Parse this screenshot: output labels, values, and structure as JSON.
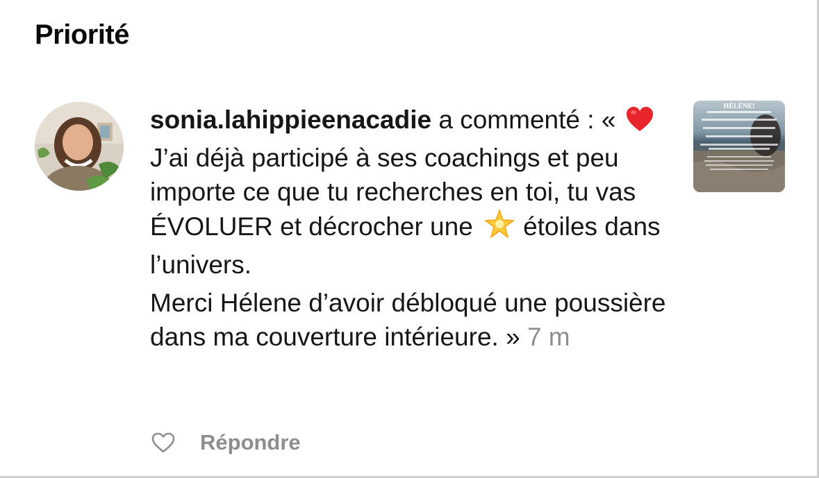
{
  "section": {
    "title": "Priorité"
  },
  "comment": {
    "username": "sonia.lahippieenacadie",
    "action": "a commenté :",
    "open_quote": "«",
    "text_part1": "J’ai déjà participé à ses coachings et peu importe ce que tu recherches en toi, tu vas ÉVOLUER et décrocher une",
    "text_part2": "étoiles dans l’univers.",
    "text_para2": "Merci Hélene d’avoir débloqué une poussière dans ma couverture intérieure. »",
    "time": "7 m",
    "icons": [
      "red-heart-emoji",
      "glowing-star-emoji"
    ]
  },
  "thumbnail": {
    "title": "HÉLÈNE!"
  },
  "actions": {
    "like_icon": "heart-outline-icon",
    "reply_label": "Répondre"
  },
  "colors": {
    "text": "#161616",
    "secondary": "#8e8e8e",
    "heart_red": "#e8252b",
    "star_yellow": "#ffc93a"
  }
}
